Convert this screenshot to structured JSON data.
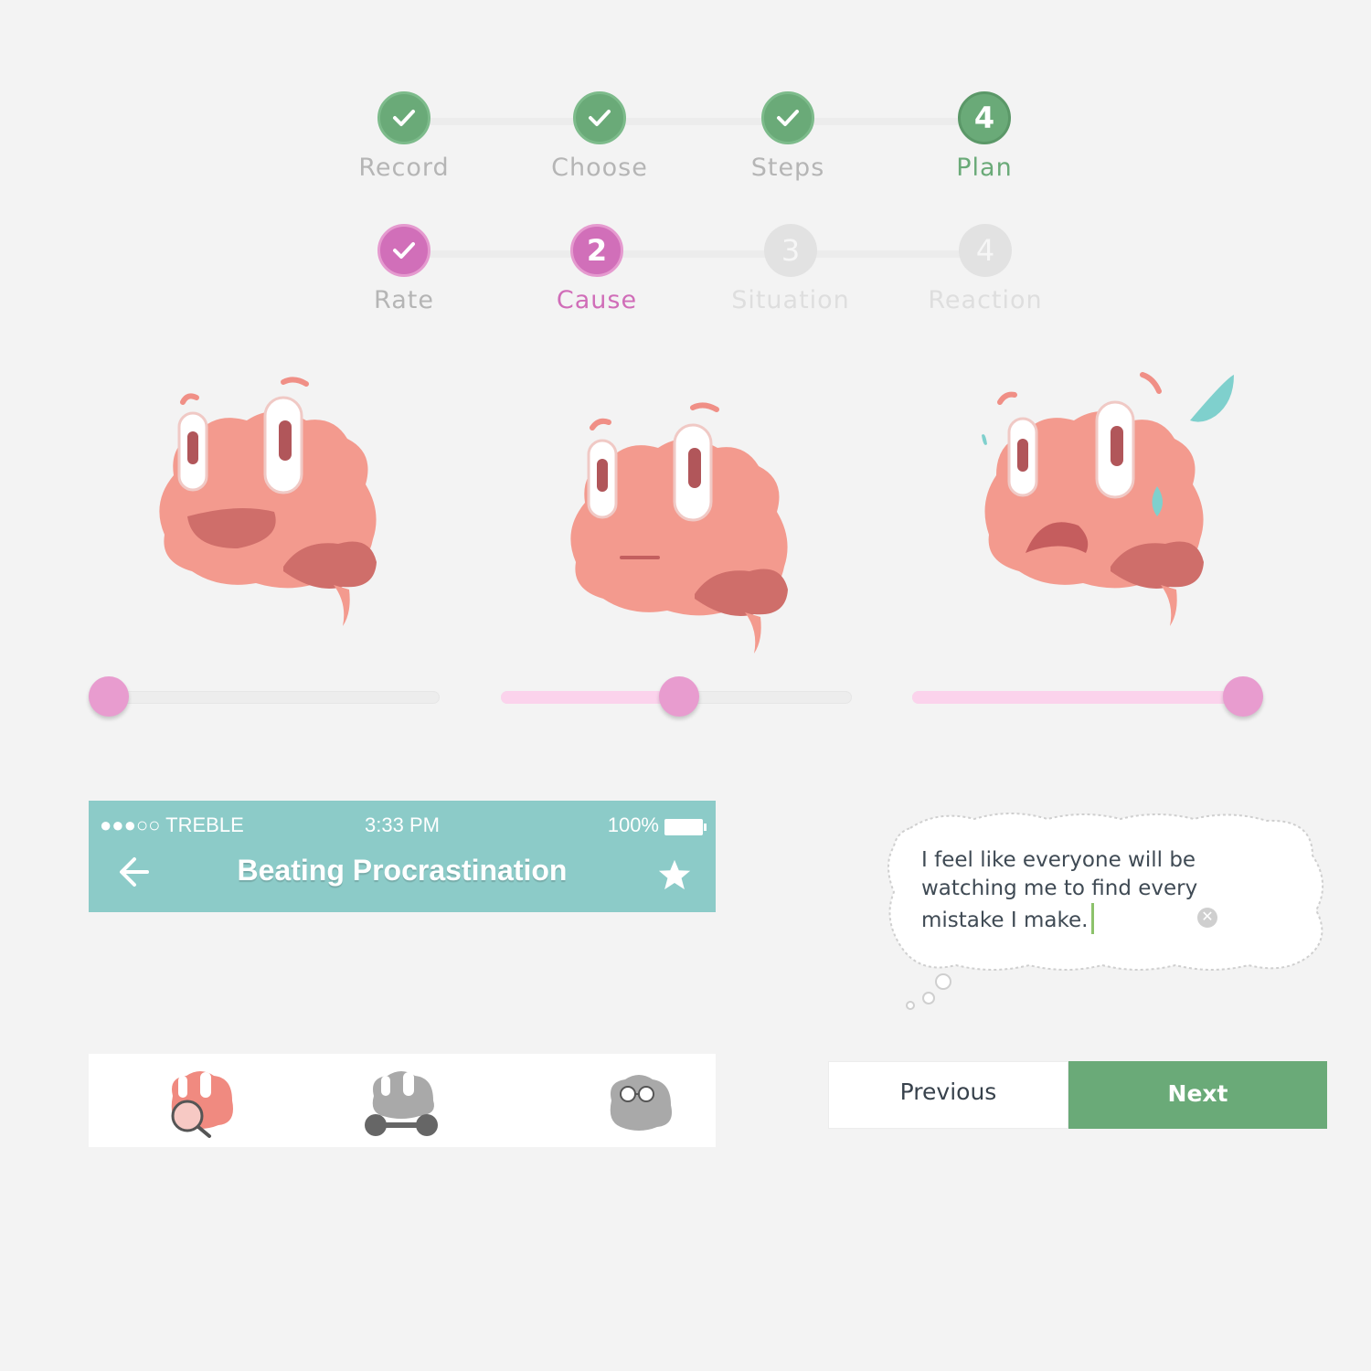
{
  "plan_stepper": {
    "steps": [
      {
        "label": "Record",
        "state": "done"
      },
      {
        "label": "Choose",
        "state": "done"
      },
      {
        "label": "Steps",
        "state": "done"
      },
      {
        "label": "Plan",
        "number": "4",
        "state": "active"
      }
    ]
  },
  "rate_stepper": {
    "steps": [
      {
        "label": "Rate",
        "state": "done"
      },
      {
        "label": "Cause",
        "number": "2",
        "state": "active"
      },
      {
        "label": "Situation",
        "number": "3",
        "state": "todo"
      },
      {
        "label": "Reaction",
        "number": "4",
        "state": "todo"
      }
    ]
  },
  "moods": [
    {
      "name": "happy-brain",
      "slider_value": 0.0
    },
    {
      "name": "neutral-brain",
      "slider_value": 0.51
    },
    {
      "name": "anxious-brain",
      "slider_value": 1.0
    }
  ],
  "appbar": {
    "carrier": "●●●○○ TREBLE",
    "time": "3:33 PM",
    "battery": "100%",
    "title": "Beating Procrastination",
    "back_icon": "arrow-left-icon",
    "favorite_icon": "star-icon"
  },
  "thought": {
    "text": "I feel like everyone will be watching me to find every mistake I make.",
    "clear_icon": "clear-circle-icon"
  },
  "tabbar": {
    "tabs": [
      {
        "icon": "brain-magnifier-icon",
        "active": true
      },
      {
        "icon": "brain-workout-icon",
        "active": false
      },
      {
        "icon": "brain-glasses-icon",
        "active": false
      }
    ]
  },
  "nav": {
    "previous_label": "Previous",
    "next_label": "Next"
  },
  "colors": {
    "green": "#6aaa78",
    "pink": "#d16fb9",
    "teal": "#8ccbc8",
    "brain": "#f39a8e"
  }
}
